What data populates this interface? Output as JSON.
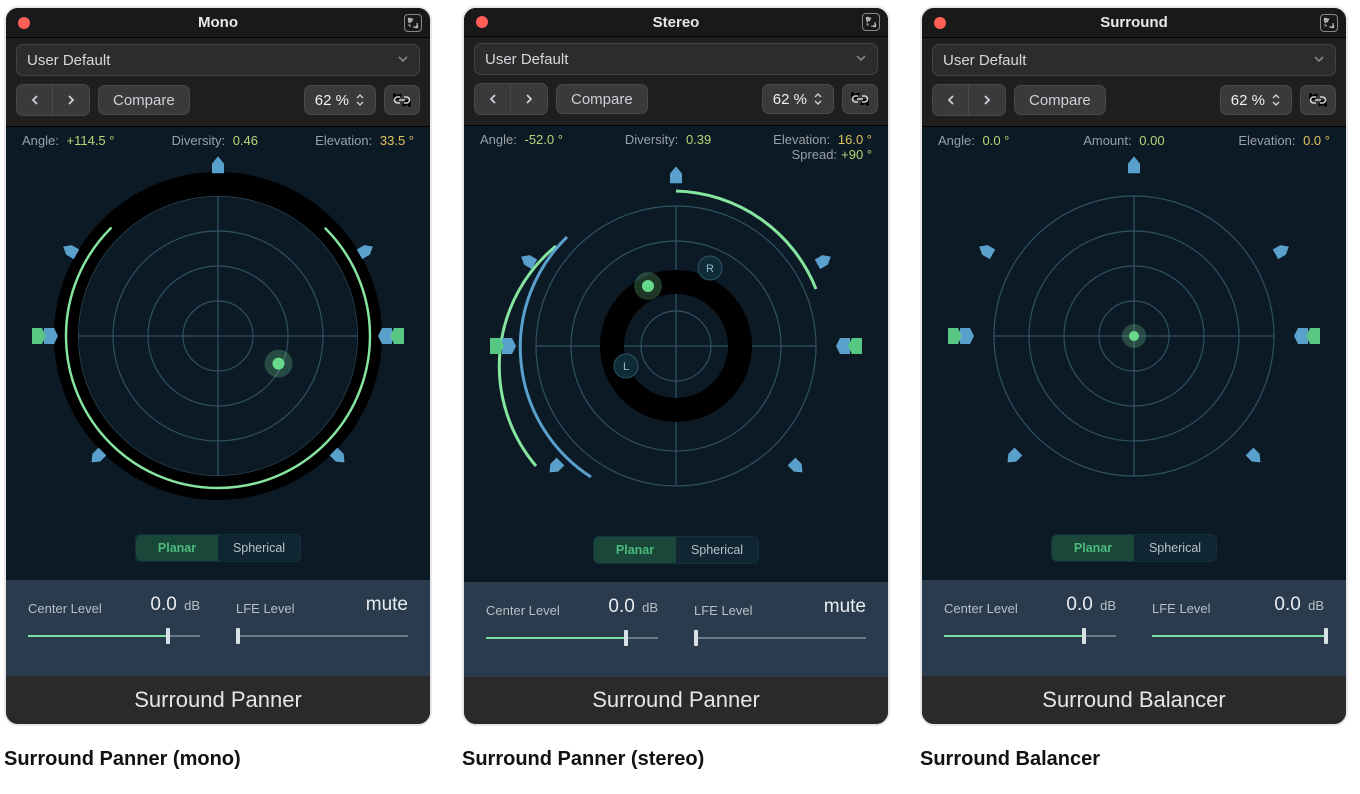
{
  "common": {
    "preset": "User Default",
    "compare": "Compare",
    "zoom": "62 %",
    "mode": {
      "planar": "Planar",
      "spherical": "Spherical"
    },
    "sliders": {
      "center": "Center Level",
      "lfe": "LFE Level",
      "db": "dB",
      "mute": "mute"
    }
  },
  "panels": [
    {
      "title": "Mono",
      "footer": "Surround Panner",
      "caption": "Surround Panner (mono)",
      "readouts": {
        "angle": {
          "k": "Angle:",
          "v": "+114.5 °"
        },
        "diversity": {
          "k": "Diversity:",
          "v": "0.46"
        },
        "elevation": {
          "k": "Elevation:",
          "v": "33.5 °"
        }
      },
      "center": {
        "val": "0.0"
      },
      "lfe": {
        "val": "mute",
        "muted": true
      }
    },
    {
      "title": "Stereo",
      "footer": "Surround Panner",
      "caption": "Surround Panner (stereo)",
      "readouts": {
        "angle": {
          "k": "Angle:",
          "v": "-52.0 °"
        },
        "diversity": {
          "k": "Diversity:",
          "v": "0.39"
        },
        "elevation": {
          "k": "Elevation:",
          "v": "16.0 °"
        },
        "spread": {
          "k": "Spread:",
          "v": "+90 °"
        }
      },
      "center": {
        "val": "0.0"
      },
      "lfe": {
        "val": "mute",
        "muted": true
      }
    },
    {
      "title": "Surround",
      "footer": "Surround Balancer",
      "caption": "Surround Balancer",
      "readouts": {
        "angle": {
          "k": "Angle:",
          "v": "0.0 °"
        },
        "amount": {
          "k": "Amount:",
          "v": "0.00"
        },
        "elevation": {
          "k": "Elevation:",
          "v": "0.0 °"
        }
      },
      "center": {
        "val": "0.0"
      },
      "lfe": {
        "val": "0.0",
        "muted": false
      }
    }
  ]
}
